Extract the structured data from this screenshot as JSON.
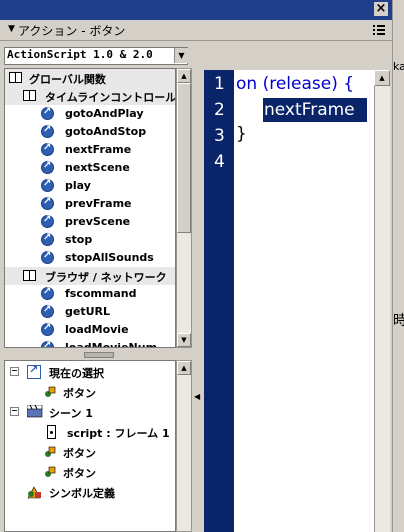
{
  "window": {
    "close_glyph": "×",
    "title": "アクション - ボタン"
  },
  "toolbox": {
    "version_select": "ActionScript 1.0 & 2.0",
    "categories": [
      {
        "label": "グローバル関数",
        "type": "book"
      },
      {
        "label": "タイムラインコントロール",
        "type": "book"
      }
    ],
    "timeline_items": [
      "gotoAndPlay",
      "gotoAndStop",
      "nextFrame",
      "nextScene",
      "play",
      "prevFrame",
      "prevScene",
      "stop",
      "stopAllSounds"
    ],
    "browser_category": "ブラウザ / ネットワーク",
    "browser_items": [
      "fscommand",
      "getURL",
      "loadMovie",
      "loadMovieNum"
    ]
  },
  "script_nav": {
    "current_selection": "現在の選択",
    "current_button": "ボタン",
    "scene": "シーン 1",
    "script_frame": "script : フレーム 1",
    "button_a": "ボタン",
    "button_b": "ボタン",
    "symbols": "シンボル定義"
  },
  "editor": {
    "line_numbers": [
      "1",
      "2",
      "3",
      "4"
    ],
    "lines": [
      "on (release) {",
      "nextFrame",
      "}",
      ""
    ],
    "selected_line": 2,
    "code_color": "#0000cc",
    "gutter_color": "#0a246a"
  },
  "right_fragments": {
    "top": "ka",
    "middle": "時"
  }
}
